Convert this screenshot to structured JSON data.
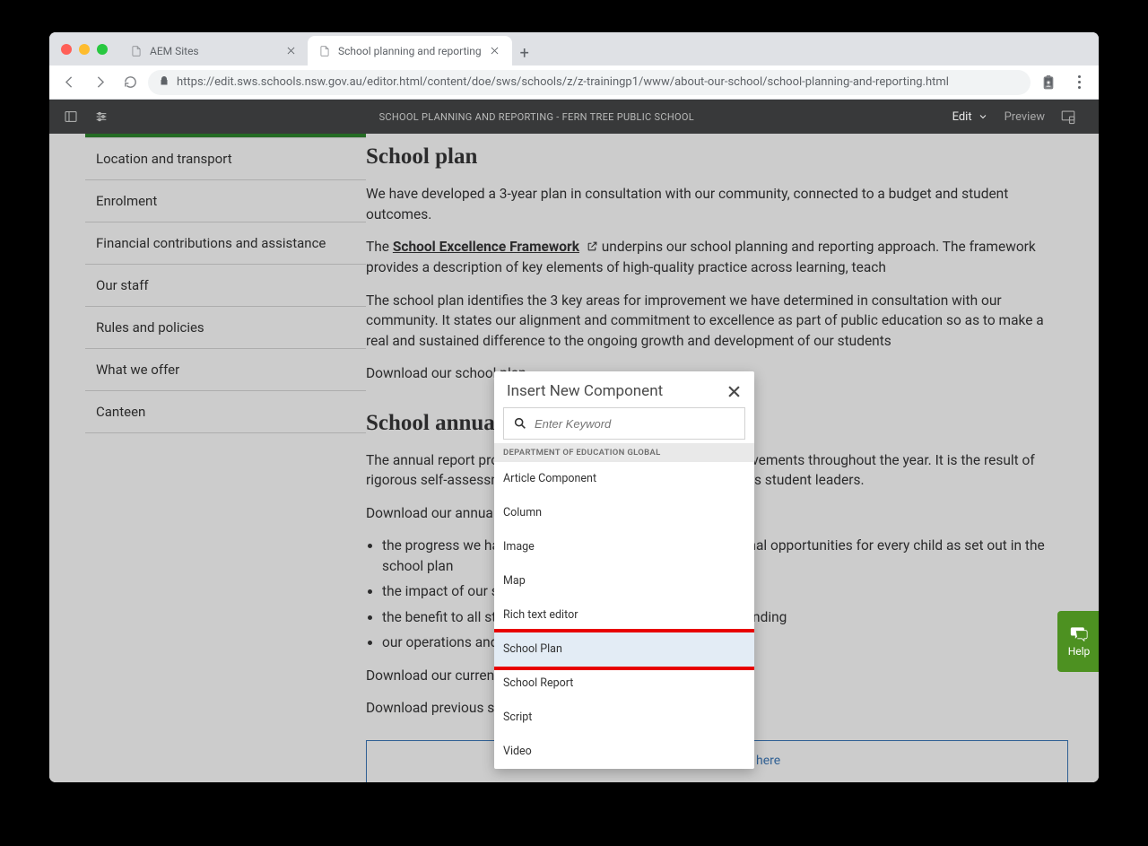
{
  "browser": {
    "tabs": [
      {
        "title": "AEM Sites",
        "active": false
      },
      {
        "title": "School planning and reporting",
        "active": true
      }
    ],
    "url": "https://edit.sws.schools.nsw.gov.au/editor.html/content/doe/sws/schools/z/z-trainingp1/www/about-our-school/school-planning-and-reporting.html"
  },
  "aem_bar": {
    "title": "SCHOOL PLANNING AND REPORTING - FERN TREE PUBLIC SCHOOL",
    "mode": "Edit",
    "preview": "Preview"
  },
  "sidebar": {
    "items": [
      "Location and transport",
      "Enrolment",
      "Financial contributions and assistance",
      "Our staff",
      "Rules and policies",
      "What we offer",
      "Canteen"
    ]
  },
  "content": {
    "h1": "School plan",
    "p1": "We have developed a 3-year plan in consultation with our community, connected to a budget and student outcomes.",
    "p2a": "The ",
    "p2_link": "School Excellence Framework",
    "p2b": " underpins our school planning and reporting approach. The framework provides a description of key elements of high-quality practice across learning, teach",
    "p3": "The school plan identifies the 3 key areas for improvement we have determined in consultation with our community. It states our alignment and commitment to excellence as part of public education so as to make a real and sustained difference to the ongoing growth and development of our students",
    "p4": "Download our school plan",
    "h2": "School annual report",
    "p5": "The annual report provides an account of operations and achievements throughout the year. It is the result of rigorous self-assessment by staff, parents and carers, as well as student leaders.",
    "p6": "Download our annual report for a full account of:",
    "li1": "the progress we have made to provide high-quality educational opportunities for every child as set out in the school plan",
    "li2": "the impact of our strategies for improved learning",
    "li3": "the benefit to all students from resources including equity funding",
    "li4": "our operations and achievements throughout the year.",
    "p7": "Download our current annual report:",
    "p8": "Download previous school plans and reports:",
    "dropzone": "Drag components here"
  },
  "dialog": {
    "title": "Insert New Component",
    "search_placeholder": "Enter Keyword",
    "group": "DEPARTMENT OF EDUCATION GLOBAL",
    "items": [
      "Article Component",
      "Column",
      "Image",
      "Map",
      "Rich text editor",
      "School Plan",
      "School Report",
      "Script",
      "Video"
    ],
    "highlighted_index": 5
  },
  "help": {
    "label": "Help"
  }
}
